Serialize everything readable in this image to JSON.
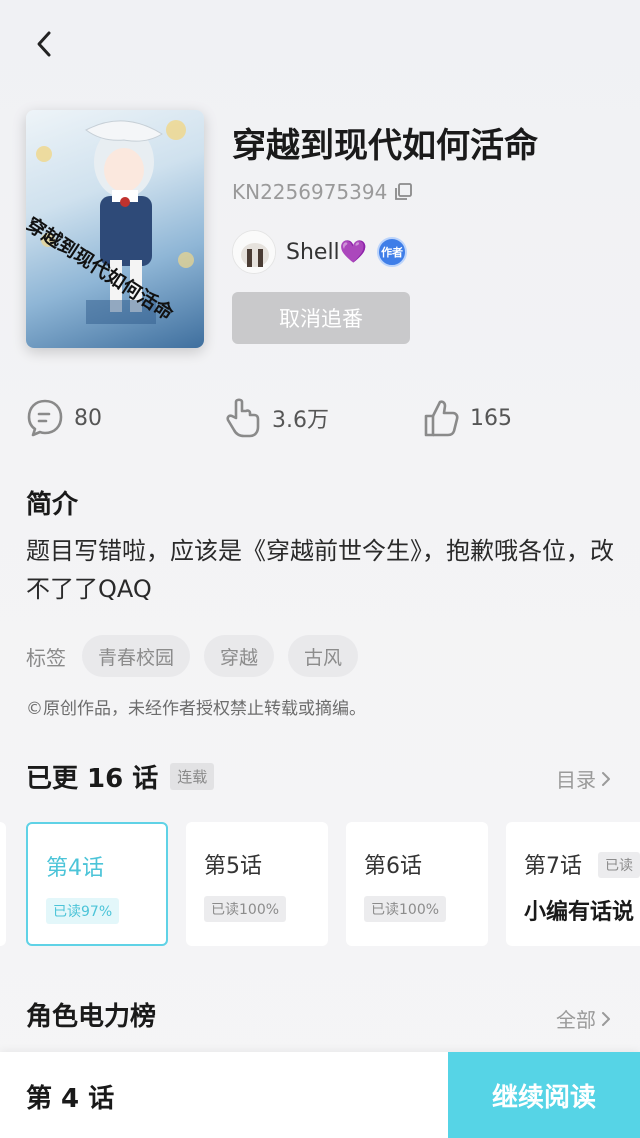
{
  "book": {
    "title": "穿越到现代如何活命",
    "cover_text": "穿越到现代如何活命",
    "id": "KN2256975394",
    "author": "Shell💜",
    "author_badge": "作者",
    "unfollow_label": "取消追番"
  },
  "stats": {
    "comments": "80",
    "likes": "3.6万",
    "thumbs": "165"
  },
  "intro": {
    "heading": "简介",
    "text": "题目写错啦，应该是《穿越前世今生》，抱歉哦各位，改不了了QAQ"
  },
  "tags": {
    "label": "标签",
    "items": [
      "青春校园",
      "穿越",
      "古风"
    ]
  },
  "copyright": "©原创作品，未经作者授权禁止转载或摘编。",
  "chapters_section": {
    "heading": "已更 16 话",
    "status": "连载",
    "more": "目录",
    "items": [
      {
        "name": "第4话",
        "read": "已读97%"
      },
      {
        "name": "第5话",
        "read": "已读100%"
      },
      {
        "name": "第6话",
        "read": "已读100%"
      },
      {
        "name": "第7话",
        "read": "已读",
        "subtitle": "小编有话说"
      }
    ]
  },
  "ranking": {
    "heading": "角色电力榜",
    "more": "全部"
  },
  "bottom": {
    "current": "第 4 话",
    "continue_label": "继续阅读"
  },
  "colors": {
    "accent": "#56d4e6",
    "badge_blue": "#3f7ee8",
    "unfollow_bg": "#c9c9cb"
  }
}
